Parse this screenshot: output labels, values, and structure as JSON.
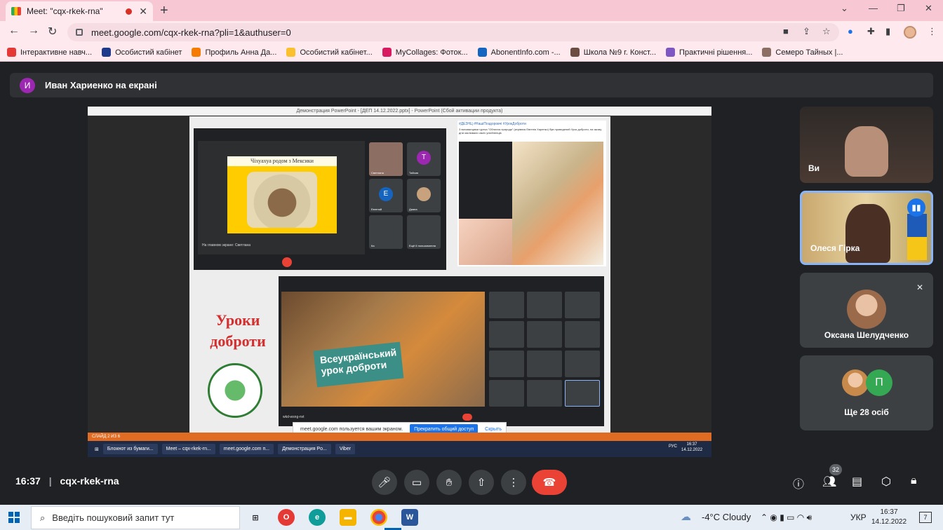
{
  "browser": {
    "tab_title": "Meet: \"cqx-rkek-rna\"",
    "tab_close": "✕",
    "new_tab": "+",
    "url": "meet.google.com/cqx-rkek-rna?pli=1&authuser=0",
    "bookmarks": [
      {
        "label": "Інтерактивне навч...",
        "color": "#e53935"
      },
      {
        "label": "Особистий кабінет",
        "color": "#1e3a8a"
      },
      {
        "label": "Профиль Анна Да...",
        "color": "#f57c00"
      },
      {
        "label": "Особистий кабінет...",
        "color": "#fbc02d"
      },
      {
        "label": "MyCollages: Фоток...",
        "color": "#d81b60"
      },
      {
        "label": "AbonentInfo.com -...",
        "color": "#1565c0"
      },
      {
        "label": "Школа №9 г. Конст...",
        "color": "#6d4c41"
      },
      {
        "label": "Практичні рішення...",
        "color": "#7e57c2"
      },
      {
        "label": "Семеро Тайных |...",
        "color": "#8d6e63"
      }
    ]
  },
  "banner": {
    "avatar_letter": "И",
    "text": "Иван Хариенко на екрані"
  },
  "shared": {
    "window_title": "Демонстрация PowerPoint - [ДЕП 14.12.2022.pptx] - PowerPoint (Сбой активации продукта)",
    "slide_heading": "Уроки доброти",
    "inner_slide_title": "Чіхуахуа родом з Мексики",
    "inner_caption": "На главном экране: Светлана",
    "tiles_labels": [
      "Светлана",
      "Тайсия",
      "Евгений",
      "Диана",
      "Ка",
      "Ещё 6 пользователя"
    ],
    "tile_letters": [
      "T",
      "E"
    ],
    "post_header": "#ДЕЗНЦ #НашіПоздоровчі #УрокДоброти",
    "post_text": "З вихованцями гуртка \"Обличчя природи\" (керівник Евгенія Харенко) був проведений Урок доброти, на якому діти малювали своїх улюбленців",
    "cat_sign": "Всеукраїнський урок доброти",
    "meet_code_inner": "wkd-wsng-nvt",
    "share_notice": "meet.google.com пользуется вашим экраном.",
    "stop_share": "Прекратить общий доступ",
    "hide": "Скрыть",
    "pp_status": "СЛАЙД 2 ИЗ 6",
    "taskbar_items": [
      "Блокнот из бумаги...",
      "Meet – cqx-rkek-rn...",
      "meet.google.com п...",
      "Демонстрация Po...",
      "Viber"
    ],
    "inner_time": "16:37",
    "inner_date": "14.12.2022",
    "inner_lang": "РУС"
  },
  "participants": [
    {
      "name": "Ви"
    },
    {
      "name": "Олеся Гірка"
    },
    {
      "name": "Оксана Шелудченко"
    },
    {
      "name": "Ще 28 осіб",
      "avatar_letter": "П"
    }
  ],
  "meeting": {
    "time": "16:37",
    "code": "cqx-rkek-rna",
    "participants_count": "32"
  },
  "windows": {
    "search_placeholder": "Введіть пошуковий запит тут",
    "weather": "-4°C Cloudy",
    "lang": "УКР",
    "time": "16:37",
    "date": "14.12.2022",
    "notif_count": "7"
  }
}
